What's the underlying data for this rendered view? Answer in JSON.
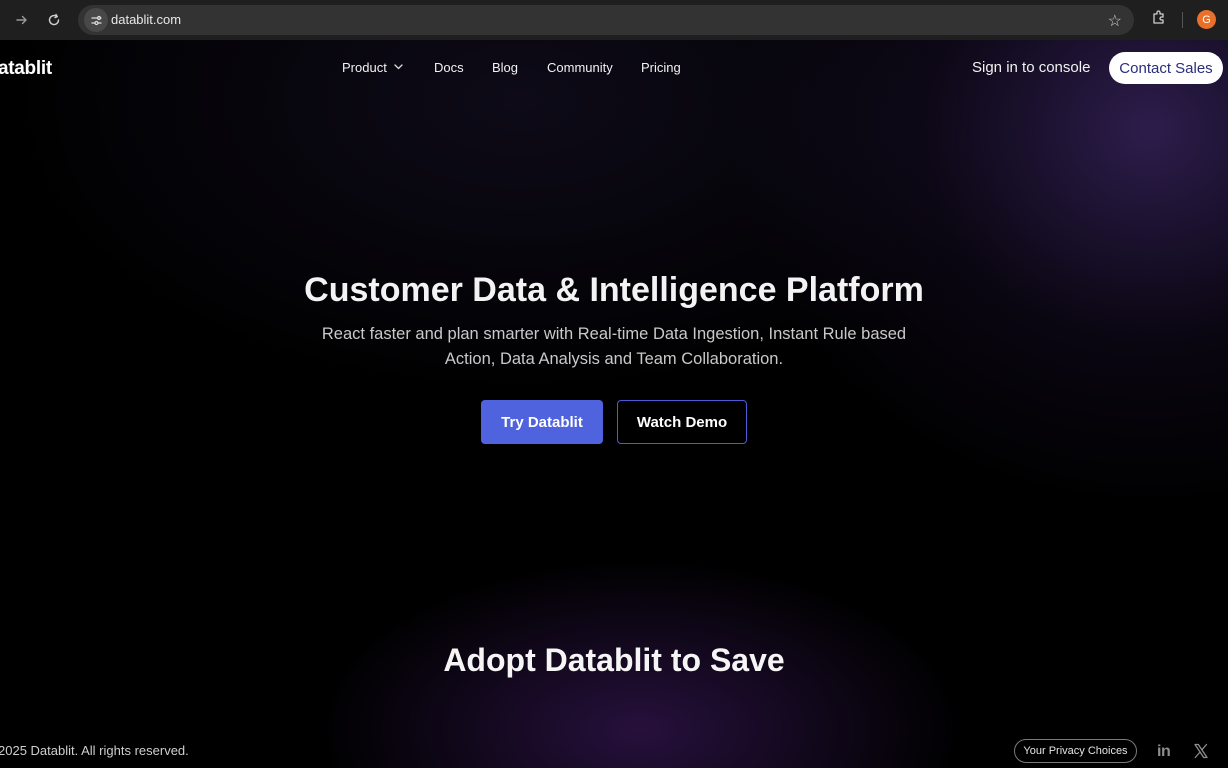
{
  "browser": {
    "url": "datablit.com",
    "avatar_letter": "G"
  },
  "header": {
    "logo": "atablit",
    "nav": {
      "product": "Product",
      "docs": "Docs",
      "blog": "Blog",
      "community": "Community",
      "pricing": "Pricing"
    },
    "signin": "Sign in to console",
    "contact": "Contact Sales"
  },
  "hero": {
    "title": "Customer Data & Intelligence Platform",
    "subtitle": "React faster and plan smarter with Real-time Data Ingestion, Instant Rule based Action, Data Analysis and Team Collaboration.",
    "primary_cta": "Try Datablit",
    "secondary_cta": "Watch Demo"
  },
  "section": {
    "title": "Adopt Datablit to Save"
  },
  "footer": {
    "copyright": "2025 Datablit. All rights reserved.",
    "privacy": "Your Privacy Choices",
    "linkedin": "in"
  },
  "colors": {
    "primary_button": "#5063df",
    "contact_text": "#2a2f7a",
    "background": "#000000"
  }
}
